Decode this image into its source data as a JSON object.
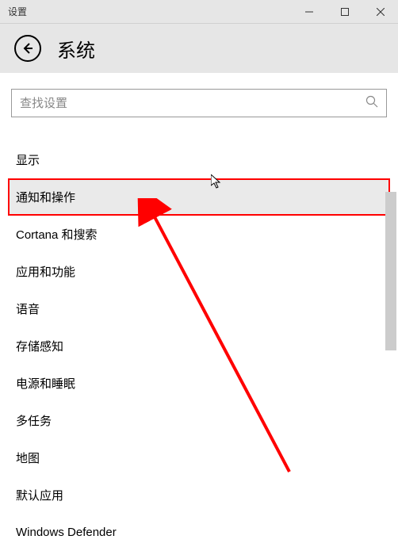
{
  "window": {
    "title": "设置"
  },
  "header": {
    "title": "系统"
  },
  "search": {
    "placeholder": "查找设置"
  },
  "items": [
    {
      "label": "显示",
      "highlighted": false
    },
    {
      "label": "通知和操作",
      "highlighted": true
    },
    {
      "label": "Cortana 和搜索",
      "highlighted": false
    },
    {
      "label": "应用和功能",
      "highlighted": false
    },
    {
      "label": "语音",
      "highlighted": false
    },
    {
      "label": "存储感知",
      "highlighted": false
    },
    {
      "label": "电源和睡眠",
      "highlighted": false
    },
    {
      "label": "多任务",
      "highlighted": false
    },
    {
      "label": "地图",
      "highlighted": false
    },
    {
      "label": "默认应用",
      "highlighted": false
    },
    {
      "label": "Windows Defender",
      "highlighted": false
    }
  ]
}
